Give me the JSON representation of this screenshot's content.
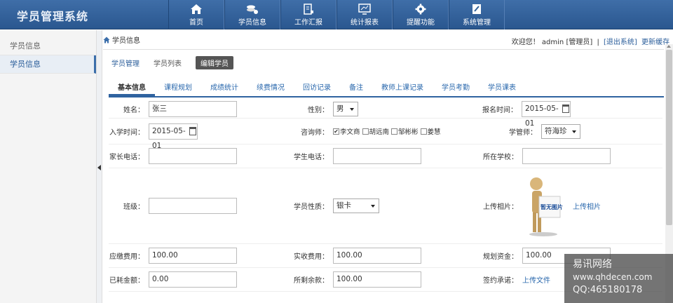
{
  "app_title": "学员管理系统",
  "nav": [
    {
      "label": "首页",
      "icon": "home-icon"
    },
    {
      "label": "学员信息",
      "icon": "coins-gear-icon"
    },
    {
      "label": "工作汇报",
      "icon": "report-icon"
    },
    {
      "label": "统计报表",
      "icon": "monitor-chart-icon"
    },
    {
      "label": "提醒功能",
      "icon": "gear-icon"
    },
    {
      "label": "系统管理",
      "icon": "edit-icon"
    }
  ],
  "sidebar": {
    "items": [
      {
        "label": "学员信息"
      },
      {
        "label": "学员信息"
      }
    ]
  },
  "breadcrumb": {
    "label": "学员信息"
  },
  "user": {
    "welcome": "欢迎您！ admin [管理员]",
    "sep": "|",
    "logout": "[退出系统]",
    "refresh": "更新缓存"
  },
  "subtabs": [
    "学员管理",
    "学员列表",
    "编辑学员"
  ],
  "tabs": [
    "基本信息",
    "课程规划",
    "成绩统计",
    "续费情况",
    "回访记录",
    "备注",
    "教师上课记录",
    "学员考勤",
    "学员课表"
  ],
  "form": {
    "name_label": "姓名：",
    "name_value": "张三",
    "gender_label": "性别：",
    "gender_value": "男",
    "reg_date_label": "报名时间：",
    "reg_date_value": "2015-05-01",
    "enroll_date_label": "入学时间：",
    "enroll_date_value": "2015-05-01",
    "advisor_label": "咨询师：",
    "advisors": [
      {
        "name": "李文商",
        "checked": "✔"
      },
      {
        "name": "胡远南",
        "checked": ""
      },
      {
        "name": "邹彬彬",
        "checked": ""
      },
      {
        "name": "姜慧",
        "checked": ""
      }
    ],
    "manager_label": "学管师：",
    "manager_value": "符海珍",
    "parent_phone_label": "家长电话：",
    "student_phone_label": "学生电话：",
    "school_label": "所在学校：",
    "class_label": "班级：",
    "nature_label": "学员性质：",
    "nature_value": "银卡",
    "photo_label": "上传相片：",
    "photo_placeholder": "暂无图片",
    "photo_link": "上传相片",
    "due_fee_label": "应缴费用：",
    "due_fee_value": "100.00",
    "paid_fee_label": "实收费用：",
    "paid_fee_value": "100.00",
    "plan_fund_label": "规划资金：",
    "plan_fund_value": "100.00",
    "spent_label": "已耗金额：",
    "spent_value": "0.00",
    "remain_label": "所剩余款：",
    "remain_value": "100.00",
    "contract_label": "签约承诺：",
    "contract_link": "上传文件"
  },
  "watermark": {
    "line1": "易讯网络",
    "line2": "www.qhdecen.com",
    "line3": "QQ:465180178"
  },
  "colors": {
    "header": "#2f5f98",
    "accent": "#2a68ad"
  }
}
